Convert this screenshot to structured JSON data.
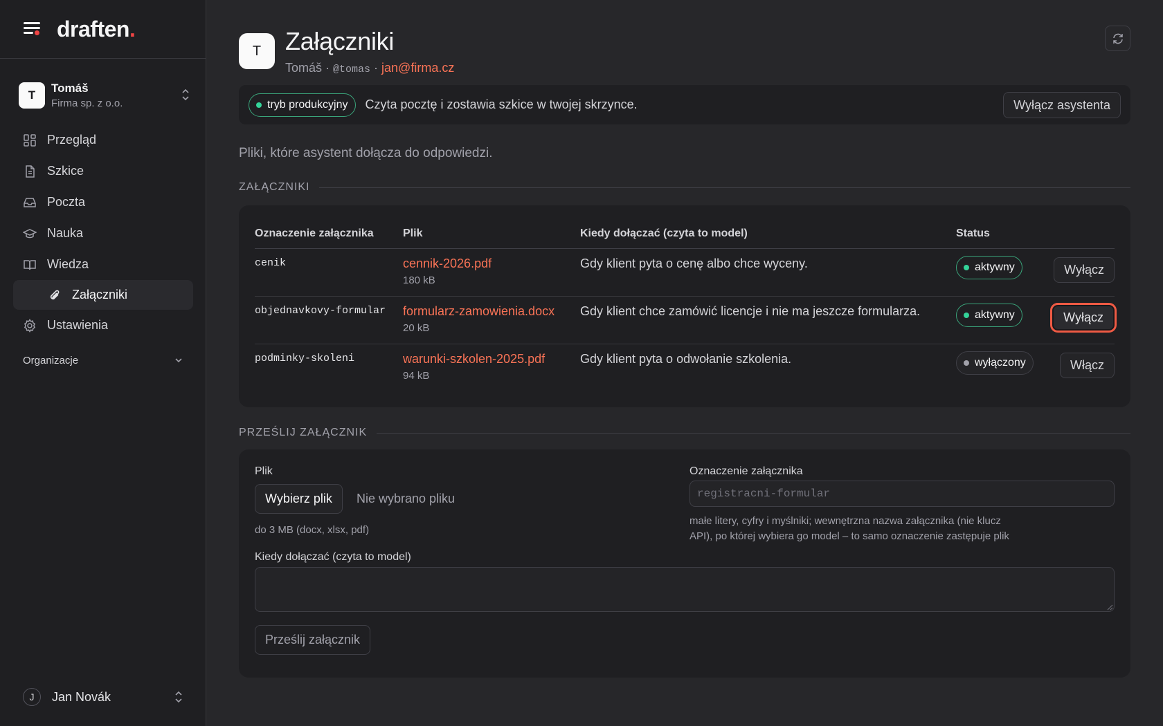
{
  "brand": {
    "name": "draften",
    "dot": "."
  },
  "workspace": {
    "initial": "T",
    "name": "Tomáš",
    "company": "Firma sp. z o.o."
  },
  "nav": {
    "items": [
      {
        "label": "Przegląd",
        "icon": "grid-icon"
      },
      {
        "label": "Szkice",
        "icon": "document-icon"
      },
      {
        "label": "Poczta",
        "icon": "inbox-icon"
      },
      {
        "label": "Nauka",
        "icon": "graduation-cap-icon"
      },
      {
        "label": "Wiedza",
        "icon": "book-icon"
      }
    ],
    "sub_active": {
      "label": "Załączniki",
      "icon": "paperclip-icon"
    },
    "settings": {
      "label": "Ustawienia",
      "icon": "gear-icon"
    },
    "org_label": "Organizacje"
  },
  "user": {
    "initial": "J",
    "name": "Jan Novák"
  },
  "header": {
    "initial": "T",
    "title": "Załączniki",
    "name": "Tomáš",
    "sep": " · ",
    "handle": "@tomas",
    "email": "jan@firma.cz"
  },
  "mode_bar": {
    "badge": "tryb produkcyjny",
    "text": "Czyta pocztę i zostawia szkice w twojej skrzynce.",
    "button": "Wyłącz asystenta"
  },
  "intro": "Pliki, które asystent dołącza do odpowiedzi.",
  "attachments_section": {
    "label": "ZAŁĄCZNIKI",
    "columns": [
      "Oznaczenie załącznika",
      "Plik",
      "Kiedy dołączać (czyta to model)",
      "Status"
    ],
    "rows": [
      {
        "key": "cenik",
        "file": "cennik-2026.pdf",
        "size": "180 kB",
        "when": "Gdy klient pyta o cenę albo chce wyceny.",
        "status": "aktywny",
        "action": "Wyłącz"
      },
      {
        "key": "objednavkovy-formular",
        "file": "formularz-zamowienia.docx",
        "size": "20 kB",
        "when": "Gdy klient chce zamówić licencje i nie ma jeszcze formularza.",
        "status": "aktywny",
        "action": "Wyłącz"
      },
      {
        "key": "podminky-skoleni",
        "file": "warunki-szkolen-2025.pdf",
        "size": "94 kB",
        "when": "Gdy klient pyta o odwołanie szkolenia.",
        "status": "wyłączony",
        "action": "Włącz"
      }
    ]
  },
  "upload_section": {
    "label": "PRZEŚLIJ ZAŁĄCZNIK",
    "file_label": "Plik",
    "choose_button": "Wybierz plik",
    "no_file": "Nie wybrano pliku",
    "file_hint": "do 3 MB (docx, xlsx, pdf)",
    "key_label": "Oznaczenie załącznika",
    "key_placeholder": "registracni-formular",
    "key_hint_1": "małe litery, cyfry i myślniki; wewnętrzna nazwa załącznika (nie klucz",
    "key_hint_2": "API), po której wybiera go model – to samo oznaczenie zastępuje plik",
    "when_label": "Kiedy dołączać (czyta to model)",
    "when_value": "",
    "submit_button": "Prześlij załącznik"
  },
  "colors": {
    "accent": "#f97356",
    "active": "#34d399",
    "focus_ring": "#ef5a44",
    "brand_dot": "#ef4444"
  }
}
